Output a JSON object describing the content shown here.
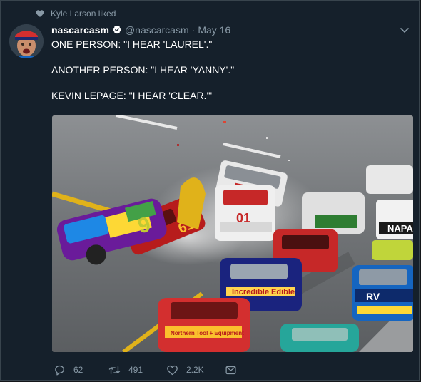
{
  "social_context": {
    "icon": "heart-icon",
    "text": "Kyle Larson liked"
  },
  "tweet": {
    "author_name": "nascarcasm",
    "verified": true,
    "handle": "@nascarcasm",
    "separator": "·",
    "date": "May 16",
    "lines": [
      "ONE PERSON: \"I HEAR 'LAUREL'.\"",
      "ANOTHER PERSON: \"I HEAR 'YANNY'.\"",
      "KEVIN LEPAGE: \"I HEAR 'CLEAR.'\""
    ],
    "media_caption_hidden": "",
    "car_numbers": [
      "9",
      "01",
      "61"
    ],
    "car_sponsors": [
      "NAPA",
      "Incredible Edible",
      "RV",
      "Northern Tool + Equipment"
    ]
  },
  "actions": {
    "reply_count": "62",
    "retweet_count": "491",
    "like_count": "2.2K"
  },
  "colors": {
    "background": "#15202b",
    "border": "#38444d",
    "muted": "#8899a6",
    "text": "#ffffff",
    "verified": "#ffffff"
  }
}
